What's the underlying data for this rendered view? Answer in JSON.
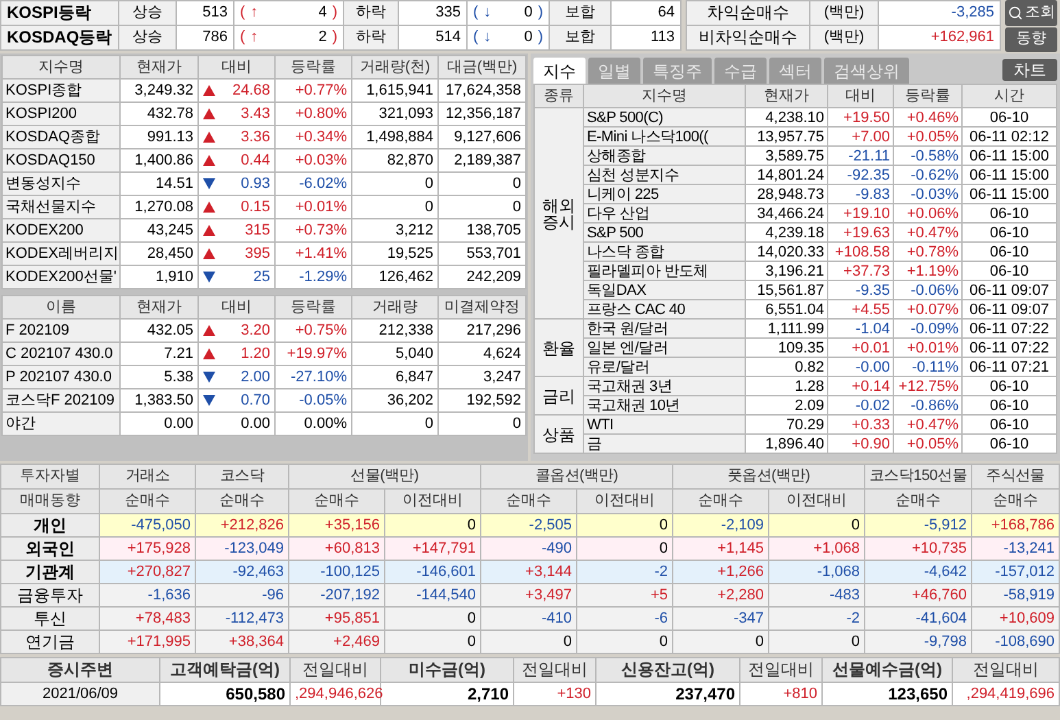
{
  "breadth": [
    {
      "label": "KOSPI등락",
      "up_label": "상승",
      "up": "513",
      "up_open": "(",
      "up_arrow": "↑",
      "up_change": "4",
      "up_close": ")",
      "down_label": "하락",
      "down": "335",
      "down_open": "(",
      "down_arrow": "↓",
      "down_change": "0",
      "down_close": ")",
      "flat_label": "보합",
      "flat": "64"
    },
    {
      "label": "KOSDAQ등락",
      "up_label": "상승",
      "up": "786",
      "up_open": "(",
      "up_arrow": "↑",
      "up_change": "2",
      "up_close": ")",
      "down_label": "하락",
      "down": "514",
      "down_open": "(",
      "down_arrow": "↓",
      "down_change": "0",
      "down_close": ")",
      "flat_label": "보합",
      "flat": "113"
    }
  ],
  "program": [
    {
      "label": "차익순매수",
      "unit": "(백만)",
      "value": "-3,285",
      "kind": "down"
    },
    {
      "label": "비차익순매수",
      "unit": "(백만)",
      "value": "+162,961",
      "kind": "up"
    }
  ],
  "buttons": [
    {
      "label": "조회",
      "kind": "search"
    },
    {
      "label": "동향",
      "kind": "plain"
    }
  ],
  "indices": {
    "columns": [
      "지수명",
      "현재가",
      "대비",
      "등락률",
      "거래량(천)",
      "대금(백만)"
    ],
    "rows": [
      {
        "name": "KOSPI종합",
        "price": "3,249.32",
        "kind": "up",
        "change": "24.68",
        "rate": "+0.77%",
        "volume": "1,615,941",
        "amount": "17,624,358"
      },
      {
        "name": "KOSPI200",
        "price": "432.78",
        "kind": "up",
        "change": "3.43",
        "rate": "+0.80%",
        "volume": "321,093",
        "amount": "12,356,187"
      },
      {
        "name": "KOSDAQ종합",
        "price": "991.13",
        "kind": "up",
        "change": "3.36",
        "rate": "+0.34%",
        "volume": "1,498,884",
        "amount": "9,127,606"
      },
      {
        "name": "KOSDAQ150",
        "price": "1,400.86",
        "kind": "up",
        "change": "0.44",
        "rate": "+0.03%",
        "volume": "82,870",
        "amount": "2,189,387"
      },
      {
        "name": "변동성지수",
        "price": "14.51",
        "kind": "down",
        "change": "0.93",
        "rate": "-6.02%",
        "volume": "0",
        "amount": "0"
      },
      {
        "name": "국채선물지수",
        "price": "1,270.08",
        "kind": "up",
        "change": "0.15",
        "rate": "+0.01%",
        "volume": "0",
        "amount": "0"
      },
      {
        "name": "KODEX200",
        "price": "43,245",
        "kind": "up",
        "change": "315",
        "rate": "+0.73%",
        "volume": "3,212",
        "amount": "138,705"
      },
      {
        "name": "KODEX레버리지",
        "price": "28,450",
        "kind": "up",
        "change": "395",
        "rate": "+1.41%",
        "volume": "19,525",
        "amount": "553,701"
      },
      {
        "name": "KODEX200선물'",
        "price": "1,910",
        "kind": "down",
        "change": "25",
        "rate": "-1.29%",
        "volume": "126,462",
        "amount": "242,209"
      }
    ]
  },
  "futures": {
    "columns": [
      "이름",
      "현재가",
      "대비",
      "등락률",
      "거래량",
      "미결제약정"
    ],
    "rows": [
      {
        "name": "F 202109",
        "price": "432.05",
        "kind": "up",
        "change": "3.20",
        "rate": "+0.75%",
        "volume": "212,338",
        "amount": "217,296"
      },
      {
        "name": "C 202107 430.0",
        "price": "7.21",
        "kind": "up",
        "change": "1.20",
        "rate": "+19.97%",
        "volume": "5,040",
        "amount": "4,624"
      },
      {
        "name": "P 202107 430.0",
        "price": "5.38",
        "kind": "down",
        "change": "2.00",
        "rate": "-27.10%",
        "volume": "6,847",
        "amount": "3,247"
      },
      {
        "name": "코스닥F 202109",
        "price": "1,383.50",
        "kind": "down",
        "change": "0.70",
        "rate": "-0.05%",
        "volume": "36,202",
        "amount": "192,592"
      },
      {
        "name": "야간",
        "price": "0.00",
        "kind": "flat",
        "change": "0.00",
        "rate": "0.00%",
        "volume": "0",
        "amount": "0"
      }
    ]
  },
  "tabs": [
    {
      "label": "지수",
      "selected": true
    },
    {
      "label": "일별",
      "selected": false
    },
    {
      "label": "특징주",
      "selected": false
    },
    {
      "label": "수급",
      "selected": false
    },
    {
      "label": "섹터",
      "selected": false
    },
    {
      "label": "검색상위",
      "selected": false
    }
  ],
  "chart_button": "차트",
  "world": {
    "columns": [
      "종류",
      "지수명",
      "현재가",
      "대비",
      "등락률",
      "시간"
    ],
    "groups": [
      {
        "name": "해외 증시",
        "rows": [
          {
            "name": "S&P 500(C)",
            "price": "4,238.10",
            "kind": "up",
            "change": "+19.50",
            "rate": "+0.46%",
            "time": "06-10"
          },
          {
            "name": "E-Mini 나스닥100((",
            "price": "13,957.75",
            "kind": "up",
            "change": "+7.00",
            "rate": "+0.05%",
            "time": "06-11 02:12"
          },
          {
            "name": "상해종합",
            "price": "3,589.75",
            "kind": "down",
            "change": "-21.11",
            "rate": "-0.58%",
            "time": "06-11 15:00"
          },
          {
            "name": "심천 성분지수",
            "price": "14,801.24",
            "kind": "down",
            "change": "-92.35",
            "rate": "-0.62%",
            "time": "06-11 15:00"
          },
          {
            "name": "니케이 225",
            "price": "28,948.73",
            "kind": "down",
            "change": "-9.83",
            "rate": "-0.03%",
            "time": "06-11 15:00"
          },
          {
            "name": "다우 산업",
            "price": "34,466.24",
            "kind": "up",
            "change": "+19.10",
            "rate": "+0.06%",
            "time": "06-10"
          },
          {
            "name": "S&P 500",
            "price": "4,239.18",
            "kind": "up",
            "change": "+19.63",
            "rate": "+0.47%",
            "time": "06-10"
          },
          {
            "name": "나스닥 종합",
            "price": "14,020.33",
            "kind": "up",
            "change": "+108.58",
            "rate": "+0.78%",
            "time": "06-10"
          },
          {
            "name": "필라델피아 반도체",
            "price": "3,196.21",
            "kind": "up",
            "change": "+37.73",
            "rate": "+1.19%",
            "time": "06-10"
          },
          {
            "name": "독일DAX",
            "price": "15,561.87",
            "kind": "down",
            "change": "-9.35",
            "rate": "-0.06%",
            "time": "06-11 09:07"
          },
          {
            "name": "프랑스 CAC 40",
            "price": "6,551.04",
            "kind": "up",
            "change": "+4.55",
            "rate": "+0.07%",
            "time": "06-11 09:07"
          }
        ]
      },
      {
        "name": "환율",
        "rows": [
          {
            "name": "한국 원/달러",
            "price": "1,111.99",
            "kind": "down",
            "change": "-1.04",
            "rate": "-0.09%",
            "time": "06-11 07:22"
          },
          {
            "name": "일본 엔/달러",
            "price": "109.35",
            "kind": "up",
            "change": "+0.01",
            "rate": "+0.01%",
            "time": "06-11 07:22"
          },
          {
            "name": "유로/달러",
            "price": "0.82",
            "kind": "down",
            "change": "-0.00",
            "rate": "-0.11%",
            "time": "06-11 07:21"
          }
        ]
      },
      {
        "name": "금리",
        "rows": [
          {
            "name": "국고채권 3년",
            "price": "1.28",
            "kind": "up",
            "change": "+0.14",
            "rate": "+12.75%",
            "time": "06-10"
          },
          {
            "name": "국고채권 10년",
            "price": "2.09",
            "kind": "down",
            "change": "-0.02",
            "rate": "-0.86%",
            "time": "06-10"
          }
        ]
      },
      {
        "name": "상품",
        "rows": [
          {
            "name": "WTI",
            "price": "70.29",
            "kind": "up",
            "change": "+0.33",
            "rate": "+0.47%",
            "time": "06-10"
          },
          {
            "name": "금",
            "price": "1,896.40",
            "kind": "up",
            "change": "+0.90",
            "rate": "+0.05%",
            "time": "06-10"
          }
        ]
      }
    ]
  },
  "investors": {
    "corner": [
      "투자자별",
      "매매동향"
    ],
    "groups": [
      {
        "label": "거래소",
        "sub": [
          "순매수"
        ]
      },
      {
        "label": "코스닥",
        "sub": [
          "순매수"
        ]
      },
      {
        "label": "선물(백만)",
        "sub": [
          "순매수",
          "이전대비"
        ]
      },
      {
        "label": "콜옵션(백만)",
        "sub": [
          "순매수",
          "이전대비"
        ]
      },
      {
        "label": "풋옵션(백만)",
        "sub": [
          "순매수",
          "이전대비"
        ]
      },
      {
        "label": "코스닥150선물",
        "sub": [
          "순매수"
        ]
      },
      {
        "label": "주식선물",
        "sub": [
          "순매수"
        ]
      }
    ],
    "rows": [
      {
        "name": "개인",
        "bold": true,
        "color": "#ffffcc",
        "values": [
          {
            "v": "-475,050",
            "kind": "down"
          },
          {
            "v": "+212,826",
            "kind": "up"
          },
          {
            "v": "+35,156",
            "kind": "up"
          },
          {
            "v": "0",
            "kind": "flat"
          },
          {
            "v": "-2,505",
            "kind": "down"
          },
          {
            "v": "0",
            "kind": "flat"
          },
          {
            "v": "-2,109",
            "kind": "down"
          },
          {
            "v": "0",
            "kind": "flat"
          },
          {
            "v": "-5,912",
            "kind": "down"
          },
          {
            "v": "+168,786",
            "kind": "up"
          }
        ]
      },
      {
        "name": "외국인",
        "bold": true,
        "color": "#fff0f5",
        "values": [
          {
            "v": "+175,928",
            "kind": "up"
          },
          {
            "v": "-123,049",
            "kind": "down"
          },
          {
            "v": "+60,813",
            "kind": "up"
          },
          {
            "v": "+147,791",
            "kind": "up"
          },
          {
            "v": "-490",
            "kind": "down"
          },
          {
            "v": "0",
            "kind": "flat"
          },
          {
            "v": "+1,145",
            "kind": "up"
          },
          {
            "v": "+1,068",
            "kind": "up"
          },
          {
            "v": "+10,735",
            "kind": "up"
          },
          {
            "v": "-13,241",
            "kind": "down"
          }
        ]
      },
      {
        "name": "기관계",
        "bold": true,
        "color": "#e4f1fb",
        "values": [
          {
            "v": "+270,827",
            "kind": "up"
          },
          {
            "v": "-92,463",
            "kind": "down"
          },
          {
            "v": "-100,125",
            "kind": "down"
          },
          {
            "v": "-146,601",
            "kind": "down"
          },
          {
            "v": "+3,144",
            "kind": "up"
          },
          {
            "v": "-2",
            "kind": "down"
          },
          {
            "v": "+1,266",
            "kind": "up"
          },
          {
            "v": "-1,068",
            "kind": "down"
          },
          {
            "v": "-4,642",
            "kind": "down"
          },
          {
            "v": "-157,012",
            "kind": "down"
          }
        ]
      },
      {
        "name": "금융투자",
        "bold": false,
        "color": "#f2f2f2",
        "values": [
          {
            "v": "-1,636",
            "kind": "down"
          },
          {
            "v": "-96",
            "kind": "down"
          },
          {
            "v": "-207,192",
            "kind": "down"
          },
          {
            "v": "-144,540",
            "kind": "down"
          },
          {
            "v": "+3,497",
            "kind": "up"
          },
          {
            "v": "+5",
            "kind": "up"
          },
          {
            "v": "+2,280",
            "kind": "up"
          },
          {
            "v": "-483",
            "kind": "down"
          },
          {
            "v": "+46,760",
            "kind": "up"
          },
          {
            "v": "-58,919",
            "kind": "down"
          }
        ]
      },
      {
        "name": "투신",
        "bold": false,
        "color": "#f2f2f2",
        "values": [
          {
            "v": "+78,483",
            "kind": "up"
          },
          {
            "v": "-112,473",
            "kind": "down"
          },
          {
            "v": "+95,851",
            "kind": "up"
          },
          {
            "v": "0",
            "kind": "flat"
          },
          {
            "v": "-410",
            "kind": "down"
          },
          {
            "v": "-6",
            "kind": "down"
          },
          {
            "v": "-347",
            "kind": "down"
          },
          {
            "v": "-2",
            "kind": "down"
          },
          {
            "v": "-41,604",
            "kind": "down"
          },
          {
            "v": "+10,609",
            "kind": "up"
          }
        ]
      },
      {
        "name": "연기금",
        "bold": false,
        "color": "#f2f2f2",
        "values": [
          {
            "v": "+171,995",
            "kind": "up"
          },
          {
            "v": "+38,364",
            "kind": "up"
          },
          {
            "v": "+2,469",
            "kind": "up"
          },
          {
            "v": "0",
            "kind": "flat"
          },
          {
            "v": "0",
            "kind": "flat"
          },
          {
            "v": "0",
            "kind": "flat"
          },
          {
            "v": "0",
            "kind": "flat"
          },
          {
            "v": "0",
            "kind": "flat"
          },
          {
            "v": "-9,798",
            "kind": "down"
          },
          {
            "v": "-108,690",
            "kind": "down"
          }
        ]
      }
    ]
  },
  "market": {
    "columns": [
      {
        "label": "증시주변",
        "bold": true
      },
      {
        "label": "고객예탁금(억)",
        "bold": true
      },
      {
        "label": "전일대비",
        "bold": false
      },
      {
        "label": "미수금(억)",
        "bold": true
      },
      {
        "label": "전일대비",
        "bold": false
      },
      {
        "label": "신용잔고(억)",
        "bold": true
      },
      {
        "label": "전일대비",
        "bold": false
      },
      {
        "label": "선물예수금(억)",
        "bold": true
      },
      {
        "label": "전일대비",
        "bold": false
      }
    ],
    "values": [
      {
        "v": "2021/06/09",
        "kind": "flat"
      },
      {
        "v": "650,580",
        "kind": "flat"
      },
      {
        "v": ",294,946,626",
        "kind": "up"
      },
      {
        "v": "2,710",
        "kind": "flat"
      },
      {
        "v": "+130",
        "kind": "up"
      },
      {
        "v": "237,470",
        "kind": "flat"
      },
      {
        "v": "+810",
        "kind": "up"
      },
      {
        "v": "123,650",
        "kind": "flat"
      },
      {
        "v": ",294,419,696",
        "kind": "up"
      }
    ]
  }
}
